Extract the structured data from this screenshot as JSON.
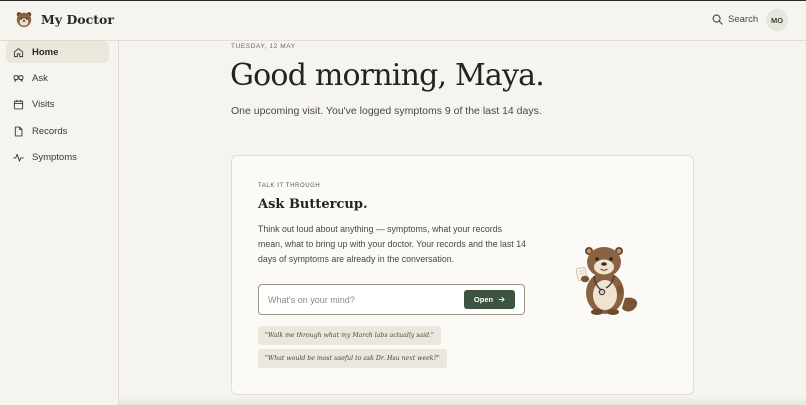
{
  "app": {
    "name": "My Doctor"
  },
  "header": {
    "search_label": "Search",
    "avatar_initials": "MO"
  },
  "nav": {
    "items": [
      {
        "label": "Home",
        "icon": "home-icon",
        "active": true
      },
      {
        "label": "Ask",
        "icon": "chat-icon",
        "active": false
      },
      {
        "label": "Visits",
        "icon": "calendar-icon",
        "active": false
      },
      {
        "label": "Records",
        "icon": "document-icon",
        "active": false
      },
      {
        "label": "Symptoms",
        "icon": "pulse-icon",
        "active": false
      }
    ]
  },
  "main": {
    "date": "TUESDAY, 12 MAY",
    "greeting": "Good morning, Maya.",
    "summary": "One upcoming visit. You've logged symptoms 9 of the last 14 days."
  },
  "card": {
    "eyebrow": "TALK IT THROUGH",
    "title": "Ask Buttercup.",
    "description": "Think out loud about anything — symptoms, what your records mean, what to bring up with your doctor. Your records and the last 14 days of symptoms are already in the conversation.",
    "input_placeholder": "What's on your mind?",
    "input_value": "",
    "open_label": "Open",
    "suggestions": [
      "\"Walk me through what my March labs actually said.\"",
      "\"What would be most useful to ask Dr. Hsu next week?\""
    ],
    "mascot": "otter-doctor-illustration"
  },
  "colors": {
    "accent": "#3d5440",
    "background": "#f6f4ee",
    "card": "#fbfaf6",
    "chip": "#ebe7dd"
  }
}
